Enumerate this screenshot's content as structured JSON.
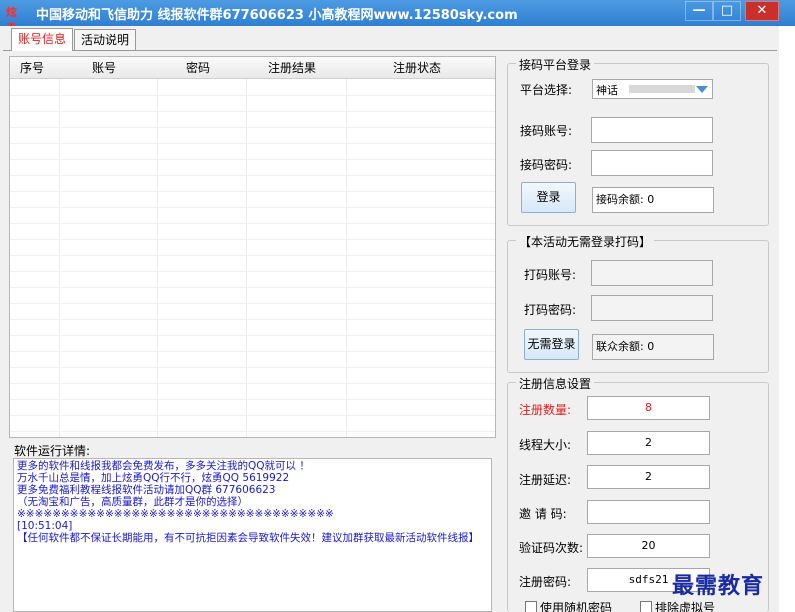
{
  "window": {
    "icon_text": "炫勇",
    "title": "中国移动和飞信助力   线报软件群677606623  小高教程网www.12580sky.com",
    "min_label": "—",
    "max_label": "□",
    "close_label": "✕"
  },
  "tabs": [
    "账号信息",
    "活动说明"
  ],
  "table": {
    "columns": [
      "序号",
      "账号",
      "密码",
      "注册结果",
      "注册状态"
    ],
    "rows": []
  },
  "log": {
    "label": "软件运行详情:",
    "lines": [
      "更多的软件和线报我都会免费发布，多多关注我的QQ就可以 ！",
      "万水千山总是情，加上炫勇QQ行不行，炫勇QQ 5619922",
      "更多免费福利教程线报软件活动请加QQ群 677606623",
      "（无淘宝和广告，高质量群，此群才是你的选择）",
      "※※※※※※※※※※※※※※※※※※※※※※※※※※※※※※※※※※※※",
      "[10:51:04]",
      "【任何软件都不保证长期能用，有不可抗拒因素会导致软件失效！建议加群获取最新活动软件线报】"
    ]
  },
  "code_platform": {
    "title": "接码平台登录",
    "platform_label": "平台选择:",
    "platform_value": "神话",
    "account_label": "接码账号:",
    "account_value": "",
    "password_label": "接码密码:",
    "password_value": "",
    "login_button": "登录",
    "balance": "接码余额: 0"
  },
  "captcha": {
    "title": "【本活动无需登录打码】",
    "account_label": "打码账号:",
    "password_label": "打码密码:",
    "no_login_button": "无需登录",
    "balance": "联众余额: 0"
  },
  "register": {
    "title": "注册信息设置",
    "count_label": "注册数量:",
    "count_value": "8",
    "threads_label": "线程大小:",
    "threads_value": "2",
    "delay_label": "注册延迟:",
    "delay_value": "2",
    "invite_label": "邀 请 码:",
    "invite_value": "",
    "verify_label": "验证码次数:",
    "verify_value": "20",
    "password_label": "注册密码:",
    "password_value": "sdfs21",
    "random_pwd_label": "使用随机密码",
    "exclude_label": "排除虚拟号"
  },
  "watermark": "最需教育",
  "colors": {
    "title_bar": "#3b8ad9",
    "accent_red": "#e02020",
    "log_text": "#1a1acc"
  }
}
